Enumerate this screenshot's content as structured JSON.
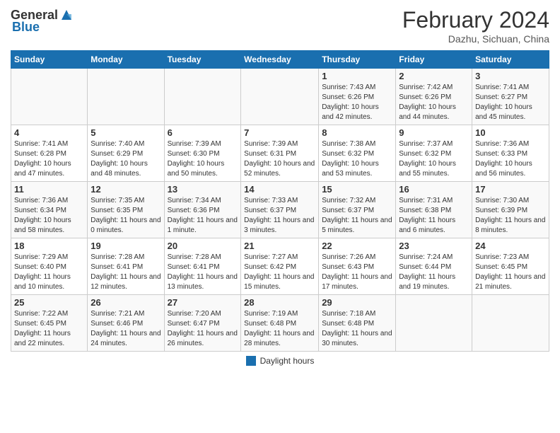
{
  "header": {
    "logo_general": "General",
    "logo_blue": "Blue",
    "month_year": "February 2024",
    "location": "Dazhu, Sichuan, China"
  },
  "calendar": {
    "days_of_week": [
      "Sunday",
      "Monday",
      "Tuesday",
      "Wednesday",
      "Thursday",
      "Friday",
      "Saturday"
    ],
    "weeks": [
      [
        {
          "day": "",
          "info": ""
        },
        {
          "day": "",
          "info": ""
        },
        {
          "day": "",
          "info": ""
        },
        {
          "day": "",
          "info": ""
        },
        {
          "day": "1",
          "info": "Sunrise: 7:43 AM\nSunset: 6:26 PM\nDaylight: 10 hours and 42 minutes."
        },
        {
          "day": "2",
          "info": "Sunrise: 7:42 AM\nSunset: 6:26 PM\nDaylight: 10 hours and 44 minutes."
        },
        {
          "day": "3",
          "info": "Sunrise: 7:41 AM\nSunset: 6:27 PM\nDaylight: 10 hours and 45 minutes."
        }
      ],
      [
        {
          "day": "4",
          "info": "Sunrise: 7:41 AM\nSunset: 6:28 PM\nDaylight: 10 hours and 47 minutes."
        },
        {
          "day": "5",
          "info": "Sunrise: 7:40 AM\nSunset: 6:29 PM\nDaylight: 10 hours and 48 minutes."
        },
        {
          "day": "6",
          "info": "Sunrise: 7:39 AM\nSunset: 6:30 PM\nDaylight: 10 hours and 50 minutes."
        },
        {
          "day": "7",
          "info": "Sunrise: 7:39 AM\nSunset: 6:31 PM\nDaylight: 10 hours and 52 minutes."
        },
        {
          "day": "8",
          "info": "Sunrise: 7:38 AM\nSunset: 6:32 PM\nDaylight: 10 hours and 53 minutes."
        },
        {
          "day": "9",
          "info": "Sunrise: 7:37 AM\nSunset: 6:32 PM\nDaylight: 10 hours and 55 minutes."
        },
        {
          "day": "10",
          "info": "Sunrise: 7:36 AM\nSunset: 6:33 PM\nDaylight: 10 hours and 56 minutes."
        }
      ],
      [
        {
          "day": "11",
          "info": "Sunrise: 7:36 AM\nSunset: 6:34 PM\nDaylight: 10 hours and 58 minutes."
        },
        {
          "day": "12",
          "info": "Sunrise: 7:35 AM\nSunset: 6:35 PM\nDaylight: 11 hours and 0 minutes."
        },
        {
          "day": "13",
          "info": "Sunrise: 7:34 AM\nSunset: 6:36 PM\nDaylight: 11 hours and 1 minute."
        },
        {
          "day": "14",
          "info": "Sunrise: 7:33 AM\nSunset: 6:37 PM\nDaylight: 11 hours and 3 minutes."
        },
        {
          "day": "15",
          "info": "Sunrise: 7:32 AM\nSunset: 6:37 PM\nDaylight: 11 hours and 5 minutes."
        },
        {
          "day": "16",
          "info": "Sunrise: 7:31 AM\nSunset: 6:38 PM\nDaylight: 11 hours and 6 minutes."
        },
        {
          "day": "17",
          "info": "Sunrise: 7:30 AM\nSunset: 6:39 PM\nDaylight: 11 hours and 8 minutes."
        }
      ],
      [
        {
          "day": "18",
          "info": "Sunrise: 7:29 AM\nSunset: 6:40 PM\nDaylight: 11 hours and 10 minutes."
        },
        {
          "day": "19",
          "info": "Sunrise: 7:28 AM\nSunset: 6:41 PM\nDaylight: 11 hours and 12 minutes."
        },
        {
          "day": "20",
          "info": "Sunrise: 7:28 AM\nSunset: 6:41 PM\nDaylight: 11 hours and 13 minutes."
        },
        {
          "day": "21",
          "info": "Sunrise: 7:27 AM\nSunset: 6:42 PM\nDaylight: 11 hours and 15 minutes."
        },
        {
          "day": "22",
          "info": "Sunrise: 7:26 AM\nSunset: 6:43 PM\nDaylight: 11 hours and 17 minutes."
        },
        {
          "day": "23",
          "info": "Sunrise: 7:24 AM\nSunset: 6:44 PM\nDaylight: 11 hours and 19 minutes."
        },
        {
          "day": "24",
          "info": "Sunrise: 7:23 AM\nSunset: 6:45 PM\nDaylight: 11 hours and 21 minutes."
        }
      ],
      [
        {
          "day": "25",
          "info": "Sunrise: 7:22 AM\nSunset: 6:45 PM\nDaylight: 11 hours and 22 minutes."
        },
        {
          "day": "26",
          "info": "Sunrise: 7:21 AM\nSunset: 6:46 PM\nDaylight: 11 hours and 24 minutes."
        },
        {
          "day": "27",
          "info": "Sunrise: 7:20 AM\nSunset: 6:47 PM\nDaylight: 11 hours and 26 minutes."
        },
        {
          "day": "28",
          "info": "Sunrise: 7:19 AM\nSunset: 6:48 PM\nDaylight: 11 hours and 28 minutes."
        },
        {
          "day": "29",
          "info": "Sunrise: 7:18 AM\nSunset: 6:48 PM\nDaylight: 11 hours and 30 minutes."
        },
        {
          "day": "",
          "info": ""
        },
        {
          "day": "",
          "info": ""
        }
      ]
    ]
  },
  "footer": {
    "legend_label": "Daylight hours"
  }
}
